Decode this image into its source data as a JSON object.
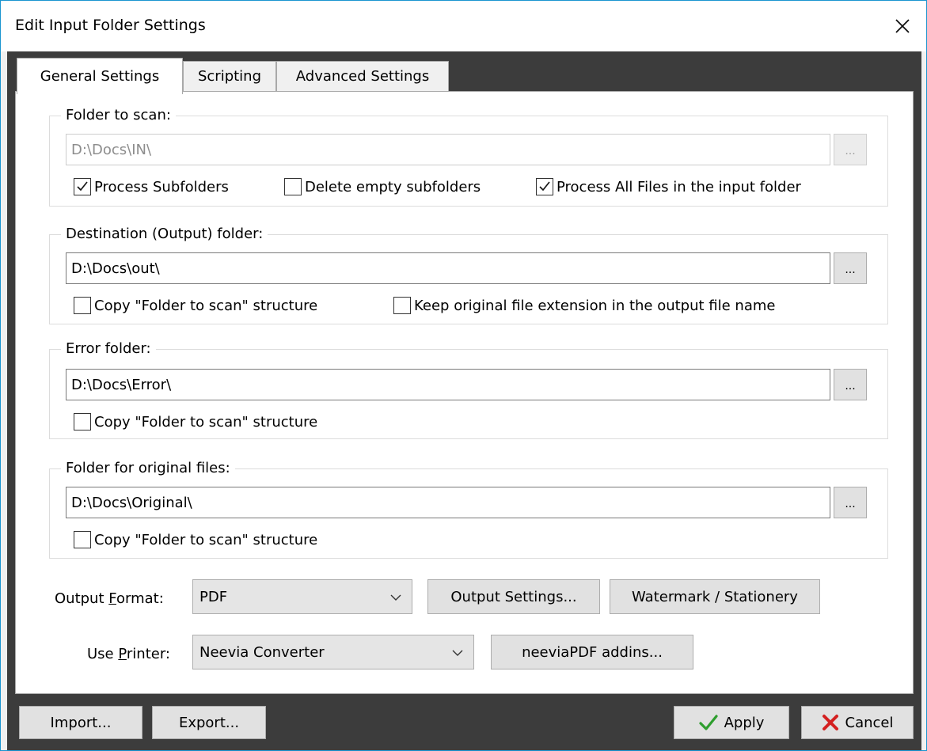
{
  "window": {
    "title": "Edit Input Folder Settings",
    "close_glyph": "✕"
  },
  "tabs": [
    {
      "label": "General Settings",
      "active": true
    },
    {
      "label": "Scripting",
      "active": false
    },
    {
      "label": "Advanced Settings",
      "active": false
    }
  ],
  "scan_folder": {
    "title": "Folder to scan:",
    "path": "D:\\Docs\\IN\\",
    "browse_label": "...",
    "process_subfolders": {
      "label": "Process Subfolders",
      "checked": true
    },
    "delete_empty": {
      "label": "Delete empty subfolders",
      "checked": false
    },
    "process_all": {
      "label": "Process All Files in the input folder",
      "checked": true
    }
  },
  "output_folder": {
    "title": "Destination (Output) folder:",
    "path": "D:\\Docs\\out\\",
    "browse_label": "...",
    "copy_structure": {
      "label": "Copy \"Folder to scan\" structure",
      "checked": false
    },
    "keep_extension": {
      "label": "Keep original file extension in the output file name",
      "checked": false
    }
  },
  "error_folder": {
    "title": "Error folder:",
    "path": "D:\\Docs\\Error\\",
    "browse_label": "...",
    "copy_structure": {
      "label": "Copy \"Folder to scan\" structure",
      "checked": false
    }
  },
  "original_folder": {
    "title": "Folder for original files:",
    "path": "D:\\Docs\\Original\\",
    "browse_label": "...",
    "copy_structure": {
      "label": "Copy \"Folder to scan\" structure",
      "checked": false
    }
  },
  "output_format": {
    "label_before": "Output ",
    "label_accel": "F",
    "label_after": "ormat:",
    "value": "PDF",
    "settings_button": "Output Settings...",
    "watermark_button": "Watermark / Stationery"
  },
  "printer": {
    "label_before": "Use ",
    "label_accel": "P",
    "label_after": "rinter:",
    "value": "Neevia Converter",
    "addins_button": "neeviaPDF addins..."
  },
  "footer": {
    "import_label": "Import...",
    "export_label": "Export...",
    "apply_label": "Apply",
    "cancel_label": "Cancel"
  },
  "colors": {
    "accent_border": "#1b95d0",
    "apply_icon": "#2e9e2e",
    "cancel_icon": "#d42020"
  }
}
